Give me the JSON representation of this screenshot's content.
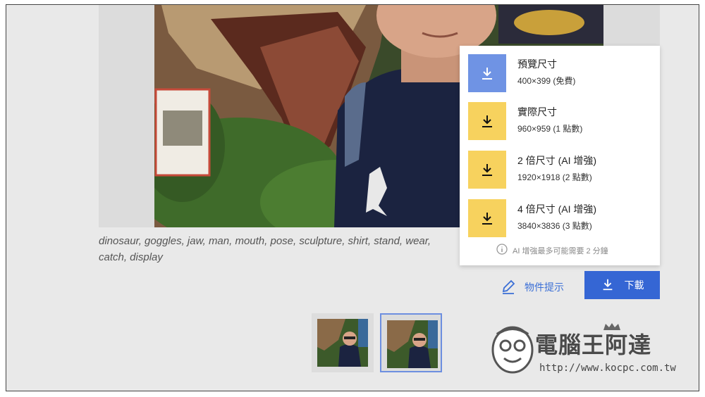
{
  "caption": "dinosaur, goggles, jaw, man, mouth, pose, sculpture, shirt, stand, wear, catch, display",
  "download_menu": {
    "items": [
      {
        "title": "預覽尺寸",
        "subtitle": "400×399 (免費)",
        "icon": "download-icon",
        "color": "#6f93e4"
      },
      {
        "title": "實際尺寸",
        "subtitle": "960×959 (1 點數)",
        "icon": "download-icon",
        "color": "#f7d25e"
      },
      {
        "title": "2 倍尺寸 (AI 增強)",
        "subtitle": "1920×1918 (2 點數)",
        "icon": "download-icon",
        "color": "#f7d25e"
      },
      {
        "title": "4 倍尺寸 (AI 增強)",
        "subtitle": "3840×3836 (3 點數)",
        "icon": "download-icon",
        "color": "#f7d25e"
      }
    ],
    "note": "AI 增強最多可能需要 2 分鐘",
    "note_icon": "info-icon"
  },
  "actions": {
    "hint_label": "物件提示",
    "hint_icon": "pencil-icon",
    "download_label": "下載",
    "download_icon": "download-icon",
    "accent": "#3566d4"
  },
  "thumbnails": [
    {
      "name": "thumbnail-1",
      "selected": false
    },
    {
      "name": "thumbnail-2",
      "selected": true
    }
  ],
  "watermark": {
    "title": "電腦王阿達",
    "url": "http://www.kocpc.com.tw"
  }
}
